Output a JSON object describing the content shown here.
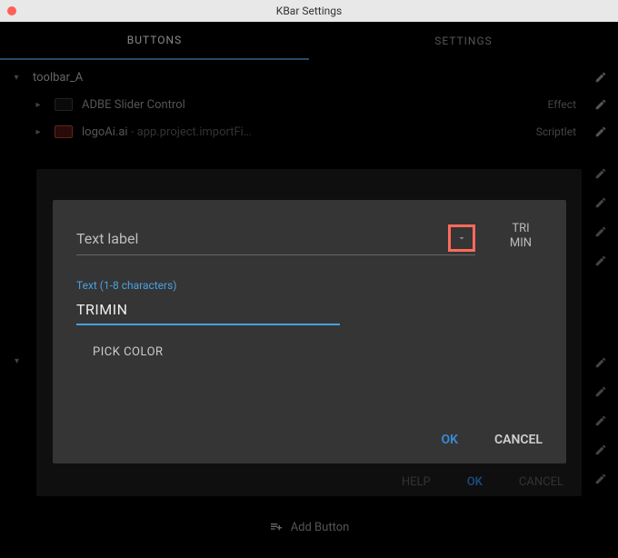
{
  "window": {
    "title": "KBar Settings"
  },
  "tabs": {
    "buttons": "BUTTONS",
    "settings": "SETTINGS",
    "active": "buttons"
  },
  "toolbars": [
    {
      "name": "toolbar_A",
      "items": [
        {
          "label": "ADBE Slider Control",
          "type": "Effect"
        },
        {
          "label": "logoAi.ai",
          "sub": "app.project.importFi…",
          "type": "Scriptlet"
        }
      ]
    }
  ],
  "add_button": "Add Button",
  "dim": {
    "help": "HELP",
    "ok": "OK",
    "cancel": "CANCEL"
  },
  "modal": {
    "dropdown_label": "Text label",
    "preview_line1": "TRI",
    "preview_line2": "MIN",
    "hint": "Text (1-8 characters)",
    "value": "TRIMIN",
    "pick_color": "PICK COLOR",
    "ok": "OK",
    "cancel": "CANCEL"
  }
}
